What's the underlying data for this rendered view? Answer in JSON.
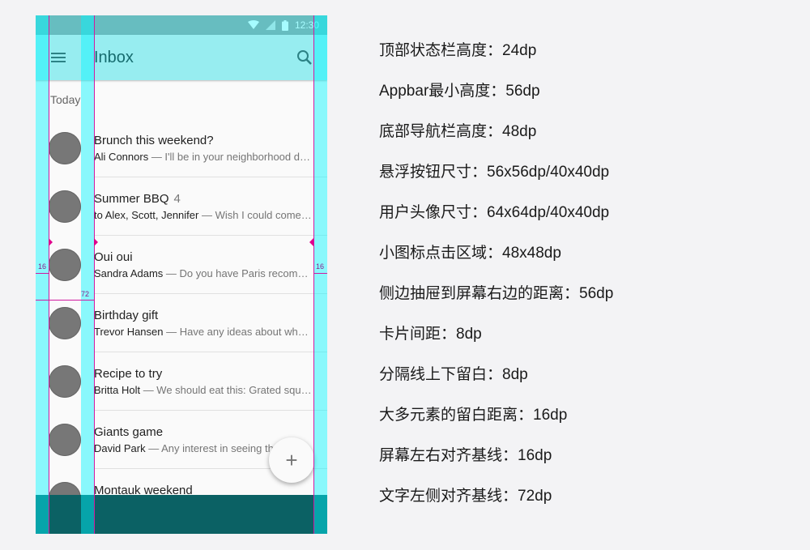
{
  "status_bar": {
    "time": "12:30",
    "icons": [
      "wifi-icon",
      "signal-icon",
      "battery-icon"
    ]
  },
  "app_bar": {
    "title": "Inbox",
    "nav_icon": "menu-icon",
    "action_icon": "search-icon"
  },
  "list": {
    "subheader": "Today",
    "items": [
      {
        "title": "Brunch this weekend?",
        "count": "",
        "sender": "Ali Connors",
        "preview": " — I'll be in your neighborhood doing errands"
      },
      {
        "title": "Summer BBQ",
        "count": "4",
        "sender": "to Alex, Scott, Jennifer",
        "preview": " — Wish I could come, but I'm out of town"
      },
      {
        "title": "Oui oui",
        "count": "",
        "sender": "Sandra Adams",
        "preview": " — Do you have Paris recommendations?"
      },
      {
        "title": "Birthday gift",
        "count": "",
        "sender": "Trevor Hansen",
        "preview": " — Have any ideas about what we should get"
      },
      {
        "title": "Recipe to try",
        "count": "",
        "sender": "Britta Holt",
        "preview": " — We should eat this: Grated squash"
      },
      {
        "title": "Giants game",
        "count": "",
        "sender": "David Park",
        "preview": " — Any interest in seeing the game"
      },
      {
        "title": "Montauk weekend",
        "count": "",
        "sender": "",
        "preview": ""
      }
    ]
  },
  "fab": {
    "label": "+",
    "icon": "add-icon"
  },
  "overlay": {
    "margin_label": "16",
    "keyline_label": "72"
  },
  "colors": {
    "overlay_cyan": "#00f6ff",
    "keyline_magenta": "#d11aa0",
    "status_bar": "#9e9e9e",
    "app_bar": "#e8e8e8",
    "nav_bar": "#111111"
  },
  "specs": [
    "顶部状态栏高度：24dp",
    "Appbar最小高度：56dp",
    "底部导航栏高度：48dp",
    "悬浮按钮尺寸：56x56dp/40x40dp",
    "用户头像尺寸：64x64dp/40x40dp",
    "小图标点击区域：48x48dp",
    "侧边抽屉到屏幕右边的距离：56dp",
    "卡片间距：8dp",
    "分隔线上下留白：8dp",
    "大多元素的留白距离：16dp",
    "屏幕左右对齐基线：16dp",
    "文字左侧对齐基线：72dp"
  ]
}
